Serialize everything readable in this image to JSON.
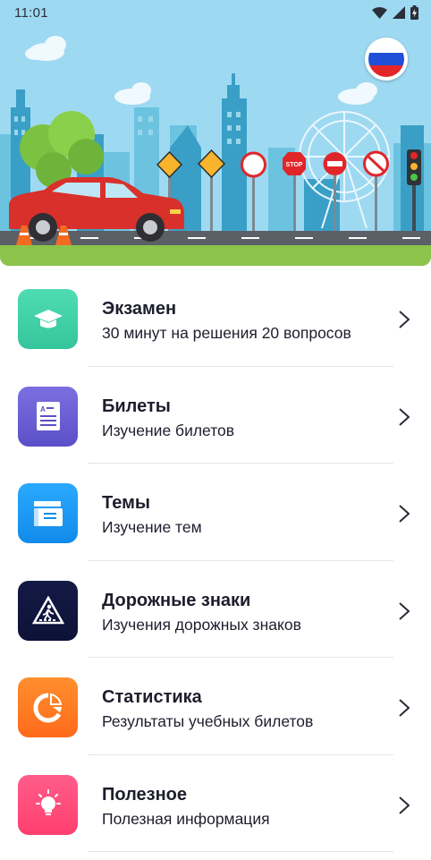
{
  "status_bar": {
    "time": "11:01",
    "icons": [
      "wifi-icon",
      "cellular-signal-icon",
      "battery-charging-icon"
    ]
  },
  "header": {
    "language_flag": "russian-flag-icon",
    "flag_colors": [
      "#ffffff",
      "#1f4fd8",
      "#e3262a"
    ]
  },
  "menu": {
    "items": [
      {
        "title": "Экзамен",
        "subtitle": "30 минут на решения 20 вопросов",
        "icon": "graduation-cap-icon",
        "color_top": "#4fdcb3",
        "color_bottom": "#35c59c"
      },
      {
        "title": "Билеты",
        "subtitle": "Изучение билетов",
        "icon": "ticket-document-icon",
        "color_top": "#7b6fe0",
        "color_bottom": "#5b50c8"
      },
      {
        "title": "Темы",
        "subtitle": "Изучение тем",
        "icon": "topics-folder-icon",
        "color_top": "#2aa9ff",
        "color_bottom": "#118bea"
      },
      {
        "title": "Дорожные знаки",
        "subtitle": "Изучения дорожных знаков",
        "icon": "pedestrian-crossing-sign-icon",
        "color_top": "#141a45",
        "color_bottom": "#0d1238"
      },
      {
        "title": "Статистика",
        "subtitle": "Результаты учебных билетов",
        "icon": "pie-chart-icon",
        "color_top": "#ff8f2e",
        "color_bottom": "#ff6a1a"
      },
      {
        "title": "Полезное",
        "subtitle": "Полезная информация",
        "icon": "lightbulb-icon",
        "color_top": "#ff5d8a",
        "color_bottom": "#ff3f6e"
      }
    ]
  }
}
